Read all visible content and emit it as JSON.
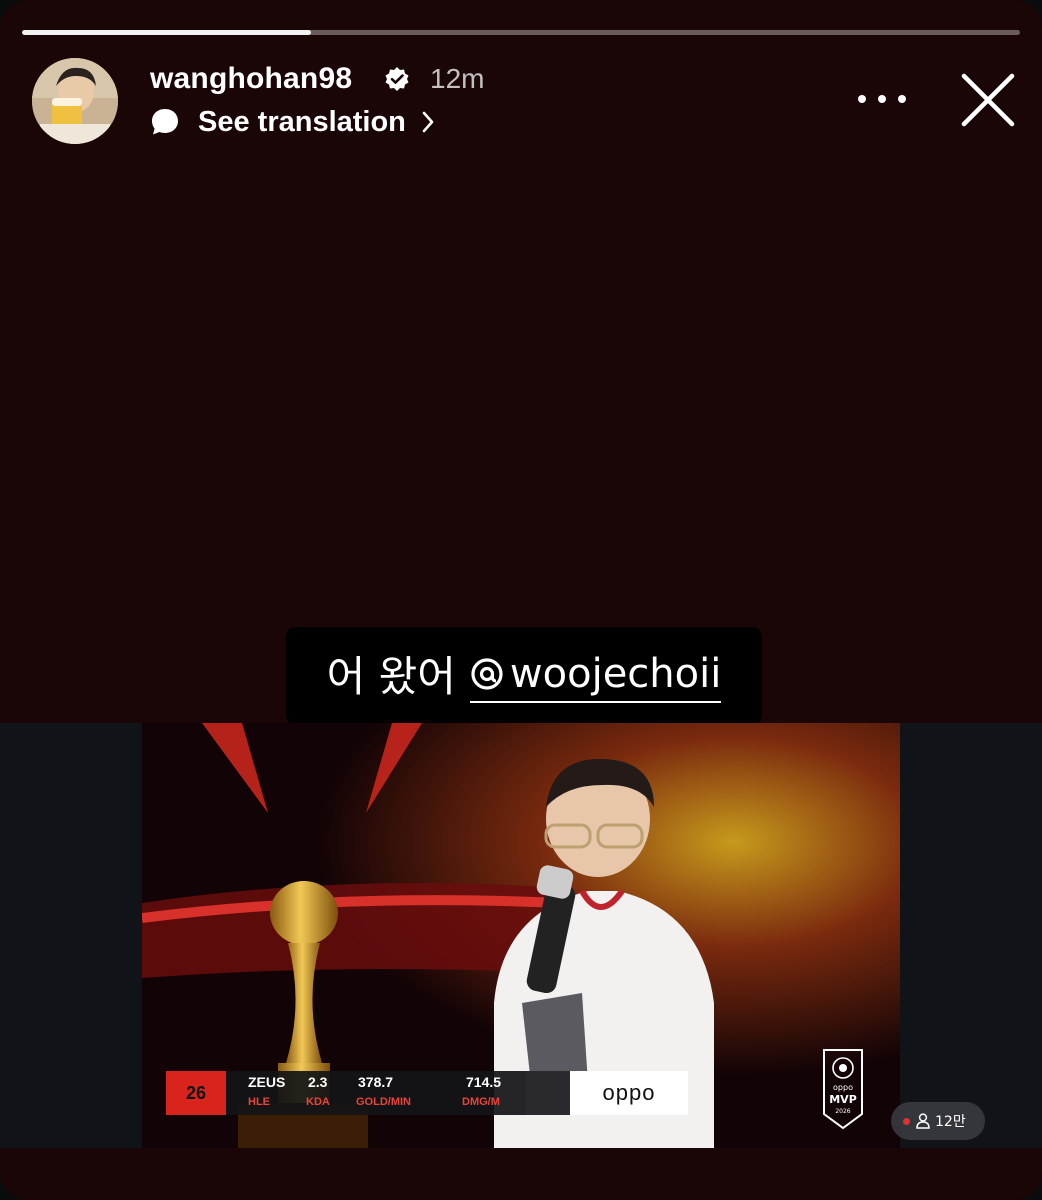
{
  "story": {
    "progress_fraction": 0.29,
    "background_color": "#1a0606"
  },
  "header": {
    "username": "wanghohan98",
    "verified": true,
    "timestamp": "12m",
    "translate_label": "See translation",
    "icons": {
      "verified": "verified-badge-icon",
      "translate": "speech-bubble-icon",
      "chevron": "chevron-right-icon",
      "more": "more-options-icon",
      "close": "close-icon"
    }
  },
  "caption": {
    "text": "어 왔어",
    "mention_handle": "woojechoii",
    "mention_icon": "threads-icon"
  },
  "media": {
    "scorebug": {
      "event": "26",
      "player": "ZEUS",
      "team": "HLE",
      "stats": [
        {
          "value": "2.3",
          "label": "KDA"
        },
        {
          "value": "378.7",
          "label": "GOLD/MIN"
        },
        {
          "value": "714.5",
          "label": "DMG/M"
        }
      ],
      "sponsor": "oppo"
    },
    "mvp_badge": {
      "brand": "oppo",
      "title": "MVP",
      "year": "2026"
    },
    "viewer_count": "12만"
  }
}
